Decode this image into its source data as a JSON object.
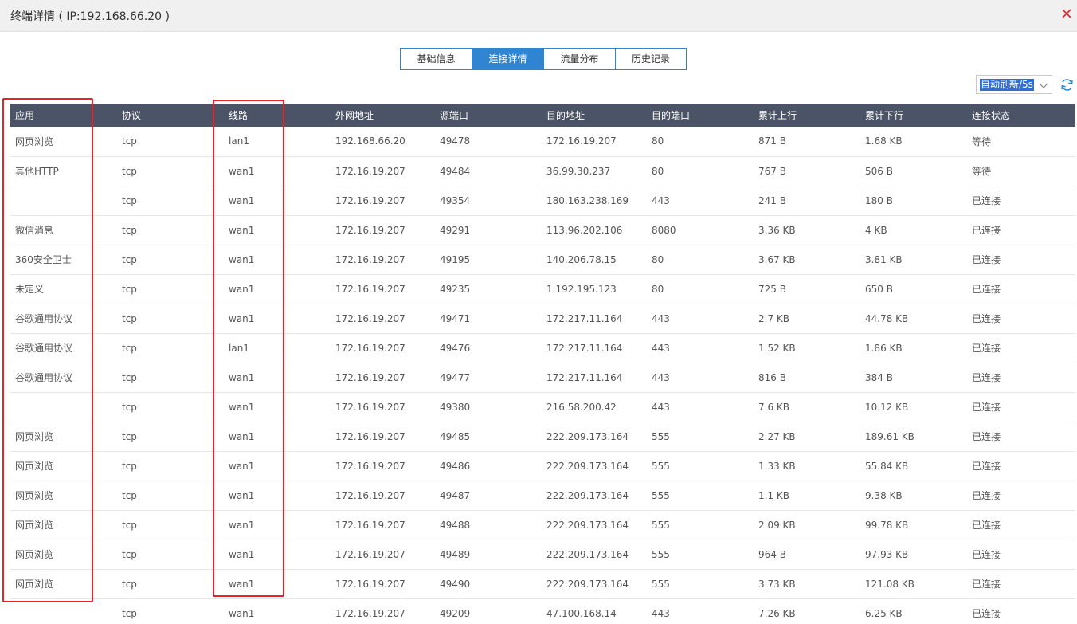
{
  "window": {
    "title": "终端详情 ( IP:192.168.66.20 )",
    "close_icon": "close-icon",
    "accent": "#2f85d1",
    "close_color": "#e3242b"
  },
  "tabs": [
    {
      "label": "基础信息",
      "active": false
    },
    {
      "label": "连接详情",
      "active": true
    },
    {
      "label": "流量分布",
      "active": false
    },
    {
      "label": "历史记录",
      "active": false
    }
  ],
  "refresh": {
    "selected": "自动刷新/5s",
    "icon": "refresh-icon"
  },
  "table": {
    "header_bg": "#4b5366",
    "columns": [
      "应用",
      "协议",
      "线路",
      "外网地址",
      "源端口",
      "目的地址",
      "目的端口",
      "累计上行",
      "累计下行",
      "连接状态"
    ],
    "rows": [
      [
        "网页浏览",
        "tcp",
        "lan1",
        "192.168.66.20",
        "49478",
        "172.16.19.207",
        "80",
        "871 B",
        "1.68 KB",
        "等待"
      ],
      [
        "其他HTTP",
        "tcp",
        "wan1",
        "172.16.19.207",
        "49484",
        "36.99.30.237",
        "80",
        "767 B",
        "506 B",
        "等待"
      ],
      [
        "",
        "tcp",
        "wan1",
        "172.16.19.207",
        "49354",
        "180.163.238.169",
        "443",
        "241 B",
        "180 B",
        "已连接"
      ],
      [
        "微信消息",
        "tcp",
        "wan1",
        "172.16.19.207",
        "49291",
        "113.96.202.106",
        "8080",
        "3.36 KB",
        "4 KB",
        "已连接"
      ],
      [
        "360安全卫士",
        "tcp",
        "wan1",
        "172.16.19.207",
        "49195",
        "140.206.78.15",
        "80",
        "3.67 KB",
        "3.81 KB",
        "已连接"
      ],
      [
        "未定义",
        "tcp",
        "wan1",
        "172.16.19.207",
        "49235",
        "1.192.195.123",
        "80",
        "725 B",
        "650 B",
        "已连接"
      ],
      [
        "谷歌通用协议",
        "tcp",
        "wan1",
        "172.16.19.207",
        "49471",
        "172.217.11.164",
        "443",
        "2.7 KB",
        "44.78 KB",
        "已连接"
      ],
      [
        "谷歌通用协议",
        "tcp",
        "lan1",
        "172.16.19.207",
        "49476",
        "172.217.11.164",
        "443",
        "1.52 KB",
        "1.86 KB",
        "已连接"
      ],
      [
        "谷歌通用协议",
        "tcp",
        "wan1",
        "172.16.19.207",
        "49477",
        "172.217.11.164",
        "443",
        "816 B",
        "384 B",
        "已连接"
      ],
      [
        "",
        "tcp",
        "wan1",
        "172.16.19.207",
        "49380",
        "216.58.200.42",
        "443",
        "7.6 KB",
        "10.12 KB",
        "已连接"
      ],
      [
        "网页浏览",
        "tcp",
        "wan1",
        "172.16.19.207",
        "49485",
        "222.209.173.164",
        "555",
        "2.27 KB",
        "189.61 KB",
        "已连接"
      ],
      [
        "网页浏览",
        "tcp",
        "wan1",
        "172.16.19.207",
        "49486",
        "222.209.173.164",
        "555",
        "1.33 KB",
        "55.84 KB",
        "已连接"
      ],
      [
        "网页浏览",
        "tcp",
        "wan1",
        "172.16.19.207",
        "49487",
        "222.209.173.164",
        "555",
        "1.1 KB",
        "9.38 KB",
        "已连接"
      ],
      [
        "网页浏览",
        "tcp",
        "wan1",
        "172.16.19.207",
        "49488",
        "222.209.173.164",
        "555",
        "2.09 KB",
        "99.78 KB",
        "已连接"
      ],
      [
        "网页浏览",
        "tcp",
        "wan1",
        "172.16.19.207",
        "49489",
        "222.209.173.164",
        "555",
        "964 B",
        "97.93 KB",
        "已连接"
      ],
      [
        "网页浏览",
        "tcp",
        "wan1",
        "172.16.19.207",
        "49490",
        "222.209.173.164",
        "555",
        "3.73 KB",
        "121.08 KB",
        "已连接"
      ],
      [
        "",
        "tcp",
        "wan1",
        "172.16.19.207",
        "49209",
        "47.100.168.14",
        "443",
        "7.26 KB",
        "6.25 KB",
        "已连接"
      ]
    ]
  }
}
